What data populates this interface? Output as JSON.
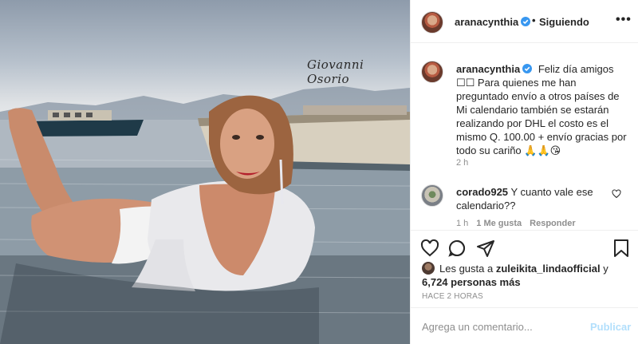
{
  "post": {
    "watermark": "Giovanni Osorio",
    "username": "aranacynthia",
    "follow_status": "Siguiendo",
    "separator": "•",
    "more_label": "•••",
    "caption_text": "Feliz día amigos ☐☐ Para quienes me han preguntado envío a otros países de Mi calendario también se estarán realizando por DHL el costo es el mismo Q. 100.00 + envío gracias por todo su cariño 🙏🙏😘",
    "caption_time": "2 h"
  },
  "comment": {
    "username": "corado925",
    "text": "Y cuanto vale ese calendario??",
    "time": "1 h",
    "likes": "1 Me gusta",
    "reply": "Responder"
  },
  "likes": {
    "prefix": "Les gusta a",
    "user": "zuleikita_lindaofficial",
    "joiner": "y",
    "others": "6,724 personas más"
  },
  "timestamp": "HACE 2 HORAS",
  "composer": {
    "placeholder": "Agrega un comentario...",
    "publish": "Publicar"
  },
  "colors": {
    "verified": "#3897f0",
    "publish_disabled": "#b2dffc",
    "muted": "#8e8e8e"
  },
  "icons": [
    "verified-badge-icon",
    "heart-icon",
    "comment-icon",
    "share-icon",
    "save-icon",
    "heart-small-icon"
  ]
}
